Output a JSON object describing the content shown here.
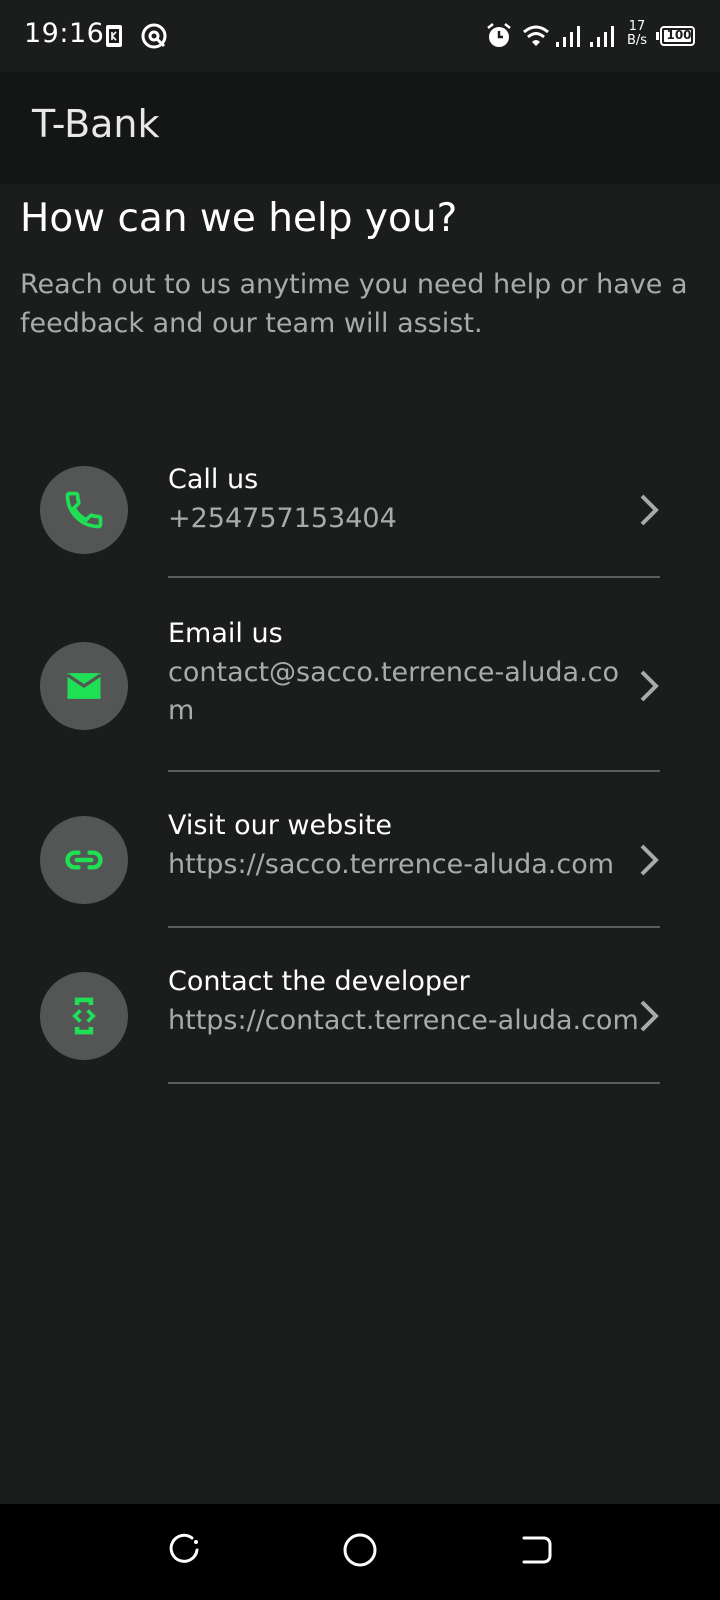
{
  "status_bar": {
    "time": "19:16",
    "network_speed_value": "17",
    "network_speed_unit": "B/s",
    "battery": "100",
    "icons": [
      "sim-toolkit-icon",
      "data-saver-icon",
      "alarm-icon",
      "wifi-icon",
      "signal-icon",
      "signal-icon",
      "battery-icon"
    ]
  },
  "app_bar": {
    "title": "T-Bank"
  },
  "main": {
    "heading": "How can we help you?",
    "subtitle": "Reach out to us anytime you need help or have a feedback and our team will assist."
  },
  "contacts": [
    {
      "title": "Call us",
      "value": "+254757153404",
      "icon": "phone-icon"
    },
    {
      "title": "Email us",
      "value": "contact@sacco.terrence-aluda.com",
      "icon": "email-icon"
    },
    {
      "title": "Visit our website",
      "value": "https://sacco.terrence-aluda.com",
      "icon": "link-icon"
    },
    {
      "title": "Contact the developer",
      "value": "https://contact.terrence-aluda.com",
      "icon": "developer-mode-icon"
    }
  ],
  "nav_bar": {
    "buttons": [
      "recents-icon",
      "home-icon",
      "back-icon"
    ]
  },
  "colors": {
    "background": "#1b1c1c",
    "app_bar": "#141515",
    "accent_green": "#1fe054",
    "icon_circle": "#545656",
    "secondary_text": "#a9abab"
  }
}
